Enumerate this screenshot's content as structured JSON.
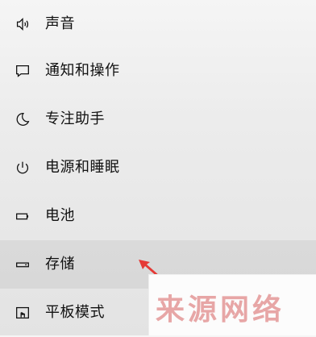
{
  "nav": {
    "items": [
      {
        "label": "声音",
        "icon": "speaker-icon"
      },
      {
        "label": "通知和操作",
        "icon": "message-icon"
      },
      {
        "label": "专注助手",
        "icon": "moon-icon"
      },
      {
        "label": "电源和睡眠",
        "icon": "power-icon"
      },
      {
        "label": "电池",
        "icon": "battery-icon"
      },
      {
        "label": "存储",
        "icon": "storage-icon",
        "selected": true
      },
      {
        "label": "平板模式",
        "icon": "tablet-mode-icon"
      }
    ]
  },
  "annotation": {
    "arrow_color": "#e53935"
  },
  "watermark": {
    "text": "来源网络",
    "color": "#e08a8a"
  }
}
